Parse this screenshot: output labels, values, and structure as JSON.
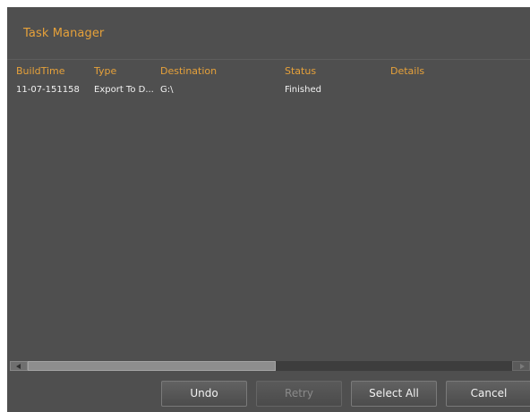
{
  "window": {
    "title": "Task Manager"
  },
  "table": {
    "columns": [
      "BuildTime",
      "Type",
      "Destination",
      "Status",
      "Details"
    ],
    "rows": [
      {
        "buildtime": "11-07-151158",
        "type": "Export To D...",
        "destination": "G:\\",
        "status": "Finished",
        "details": ""
      }
    ]
  },
  "buttons": {
    "undo": "Undo",
    "retry": "Retry",
    "select_all": "Select All",
    "cancel": "Cancel"
  },
  "colors": {
    "accent": "#e6a13a",
    "background": "#4f4f4f",
    "text": "#f2f2f2"
  }
}
